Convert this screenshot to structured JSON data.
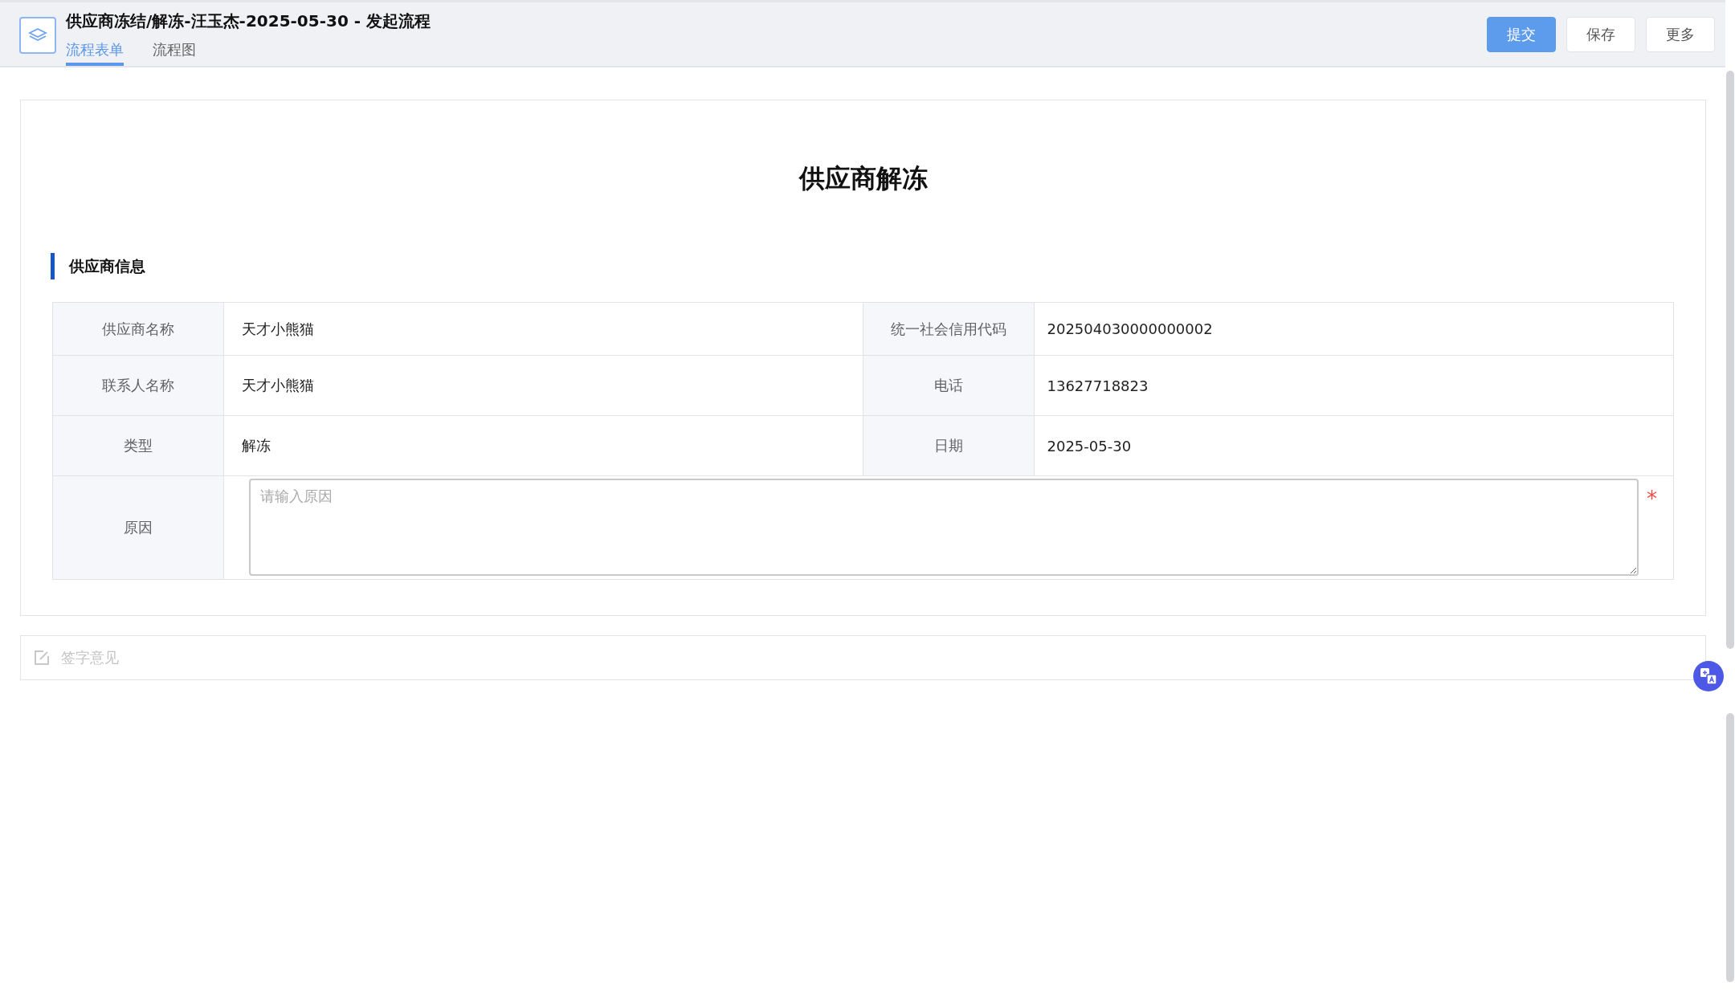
{
  "header": {
    "title": "供应商冻结/解冻-汪玉杰-2025-05-30 - 发起流程",
    "tabs": [
      {
        "label": "流程表单",
        "selected": true
      },
      {
        "label": "流程图",
        "selected": false
      }
    ],
    "buttons": [
      {
        "label": "提交",
        "kind": "primary"
      },
      {
        "label": "保存",
        "kind": "default"
      },
      {
        "label": "更多",
        "kind": "default"
      }
    ]
  },
  "form": {
    "title": "供应商解冻",
    "section": "供应商信息",
    "rows": [
      [
        {
          "label": "供应商名称",
          "value": "天才小熊猫"
        },
        {
          "label": "统一社会信用代码",
          "value": "202504030000000002"
        }
      ],
      [
        {
          "label": "联系人名称",
          "value": "天才小熊猫"
        },
        {
          "label": "电话",
          "value": "13627718823"
        }
      ],
      [
        {
          "label": "类型",
          "value": "解冻"
        },
        {
          "label": "日期",
          "value": "2025-05-30"
        }
      ]
    ],
    "reason": {
      "label": "原因",
      "placeholder": "请输入原因",
      "required_mark": "*"
    }
  },
  "sign_opinion": {
    "label": "签字意见"
  }
}
